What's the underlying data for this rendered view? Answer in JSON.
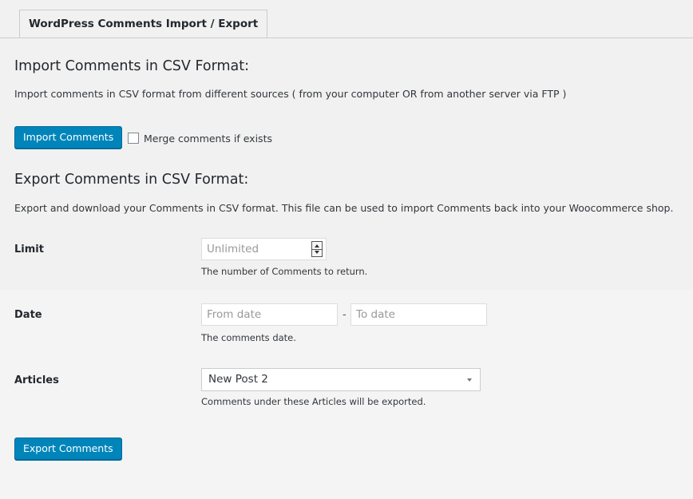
{
  "tab": {
    "label": "WordPress Comments Import / Export"
  },
  "import": {
    "heading": "Import Comments in CSV Format:",
    "description": "Import comments in CSV format from different sources ( from your computer OR from another server via FTP )",
    "button_label": "Import Comments",
    "merge_label": "Merge comments if exists",
    "merge_checked": false
  },
  "export": {
    "heading": "Export Comments in CSV Format:",
    "description": "Export and download your Comments in CSV format. This file can be used to import Comments back into your Woocommerce shop.",
    "limit": {
      "label": "Limit",
      "placeholder": "Unlimited",
      "help": "The number of Comments to return."
    },
    "date": {
      "label": "Date",
      "from_placeholder": "From date",
      "separator": "-",
      "to_placeholder": "To date",
      "help": "The comments date."
    },
    "articles": {
      "label": "Articles",
      "selected": "New Post 2",
      "help": "Comments under these Articles will be exported."
    },
    "button_label": "Export Comments"
  },
  "colors": {
    "primary_button": "#0085ba",
    "background": "#f1f1f1"
  }
}
